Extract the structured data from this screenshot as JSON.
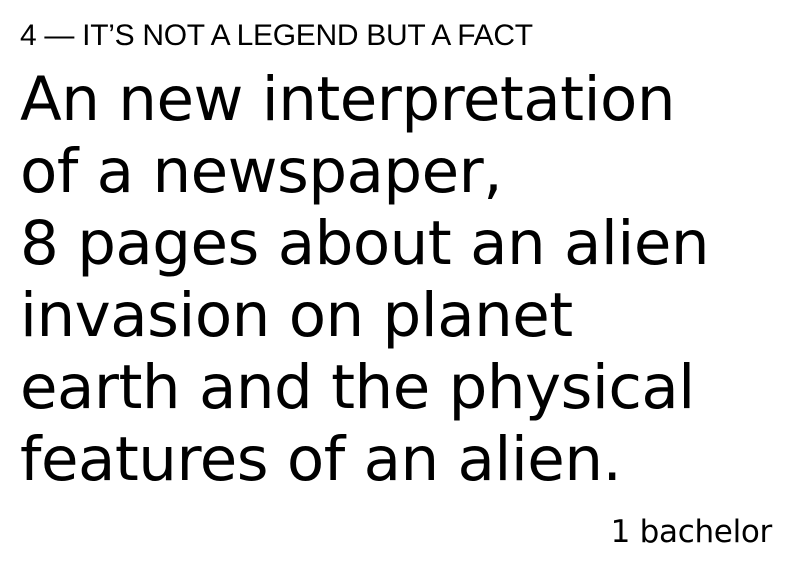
{
  "kicker": "4 — IT’S NOT A LEGEND BUT A FACT",
  "headline": {
    "lines": [
      "An new interpretation",
      "of a newspaper,",
      "8 pages about an alien",
      "invasion on planet",
      "earth and the physical",
      "features of an alien."
    ]
  },
  "footer": {
    "label": "1 bachelor"
  }
}
